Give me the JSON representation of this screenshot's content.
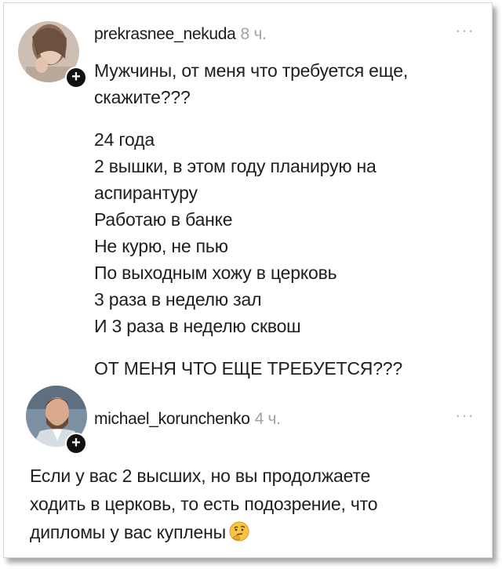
{
  "comments": [
    {
      "username": "prekrasnee_nekuda",
      "time": "8 ч.",
      "more": "···",
      "plus": "+",
      "lead": [
        "Мужчины, от меня что требуется еще,",
        "скажите???"
      ],
      "list": [
        "24 года",
        "2 вышки, в этом году планирую на",
        "аспирантуру",
        "Работаю в банке",
        "Не курю, не пью",
        "По выходным хожу в церковь",
        "3 раза в неделю зал",
        "И 3 раза в неделю сквош"
      ],
      "closing": "ОТ МЕНЯ ЧТО ЕЩЕ ТРЕБУЕТСЯ???"
    },
    {
      "username": "michael_korunchenko",
      "time": "4 ч.",
      "more": "···",
      "plus": "+",
      "body": [
        "Если у вас 2 высших, но вы продолжаете",
        "ходить в церковь, то есть подозрение, что",
        "дипломы у вас куплены"
      ],
      "emoji": "thinking-face-icon"
    }
  ]
}
